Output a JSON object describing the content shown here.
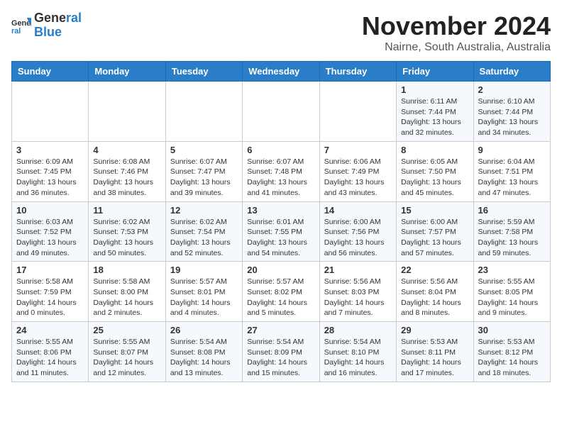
{
  "header": {
    "logo_line1": "General",
    "logo_line2": "Blue",
    "month": "November 2024",
    "location": "Nairne, South Australia, Australia"
  },
  "days_of_week": [
    "Sunday",
    "Monday",
    "Tuesday",
    "Wednesday",
    "Thursday",
    "Friday",
    "Saturday"
  ],
  "weeks": [
    [
      {
        "day": "",
        "info": ""
      },
      {
        "day": "",
        "info": ""
      },
      {
        "day": "",
        "info": ""
      },
      {
        "day": "",
        "info": ""
      },
      {
        "day": "",
        "info": ""
      },
      {
        "day": "1",
        "info": "Sunrise: 6:11 AM\nSunset: 7:44 PM\nDaylight: 13 hours\nand 32 minutes."
      },
      {
        "day": "2",
        "info": "Sunrise: 6:10 AM\nSunset: 7:44 PM\nDaylight: 13 hours\nand 34 minutes."
      }
    ],
    [
      {
        "day": "3",
        "info": "Sunrise: 6:09 AM\nSunset: 7:45 PM\nDaylight: 13 hours\nand 36 minutes."
      },
      {
        "day": "4",
        "info": "Sunrise: 6:08 AM\nSunset: 7:46 PM\nDaylight: 13 hours\nand 38 minutes."
      },
      {
        "day": "5",
        "info": "Sunrise: 6:07 AM\nSunset: 7:47 PM\nDaylight: 13 hours\nand 39 minutes."
      },
      {
        "day": "6",
        "info": "Sunrise: 6:07 AM\nSunset: 7:48 PM\nDaylight: 13 hours\nand 41 minutes."
      },
      {
        "day": "7",
        "info": "Sunrise: 6:06 AM\nSunset: 7:49 PM\nDaylight: 13 hours\nand 43 minutes."
      },
      {
        "day": "8",
        "info": "Sunrise: 6:05 AM\nSunset: 7:50 PM\nDaylight: 13 hours\nand 45 minutes."
      },
      {
        "day": "9",
        "info": "Sunrise: 6:04 AM\nSunset: 7:51 PM\nDaylight: 13 hours\nand 47 minutes."
      }
    ],
    [
      {
        "day": "10",
        "info": "Sunrise: 6:03 AM\nSunset: 7:52 PM\nDaylight: 13 hours\nand 49 minutes."
      },
      {
        "day": "11",
        "info": "Sunrise: 6:02 AM\nSunset: 7:53 PM\nDaylight: 13 hours\nand 50 minutes."
      },
      {
        "day": "12",
        "info": "Sunrise: 6:02 AM\nSunset: 7:54 PM\nDaylight: 13 hours\nand 52 minutes."
      },
      {
        "day": "13",
        "info": "Sunrise: 6:01 AM\nSunset: 7:55 PM\nDaylight: 13 hours\nand 54 minutes."
      },
      {
        "day": "14",
        "info": "Sunrise: 6:00 AM\nSunset: 7:56 PM\nDaylight: 13 hours\nand 56 minutes."
      },
      {
        "day": "15",
        "info": "Sunrise: 6:00 AM\nSunset: 7:57 PM\nDaylight: 13 hours\nand 57 minutes."
      },
      {
        "day": "16",
        "info": "Sunrise: 5:59 AM\nSunset: 7:58 PM\nDaylight: 13 hours\nand 59 minutes."
      }
    ],
    [
      {
        "day": "17",
        "info": "Sunrise: 5:58 AM\nSunset: 7:59 PM\nDaylight: 14 hours\nand 0 minutes."
      },
      {
        "day": "18",
        "info": "Sunrise: 5:58 AM\nSunset: 8:00 PM\nDaylight: 14 hours\nand 2 minutes."
      },
      {
        "day": "19",
        "info": "Sunrise: 5:57 AM\nSunset: 8:01 PM\nDaylight: 14 hours\nand 4 minutes."
      },
      {
        "day": "20",
        "info": "Sunrise: 5:57 AM\nSunset: 8:02 PM\nDaylight: 14 hours\nand 5 minutes."
      },
      {
        "day": "21",
        "info": "Sunrise: 5:56 AM\nSunset: 8:03 PM\nDaylight: 14 hours\nand 7 minutes."
      },
      {
        "day": "22",
        "info": "Sunrise: 5:56 AM\nSunset: 8:04 PM\nDaylight: 14 hours\nand 8 minutes."
      },
      {
        "day": "23",
        "info": "Sunrise: 5:55 AM\nSunset: 8:05 PM\nDaylight: 14 hours\nand 9 minutes."
      }
    ],
    [
      {
        "day": "24",
        "info": "Sunrise: 5:55 AM\nSunset: 8:06 PM\nDaylight: 14 hours\nand 11 minutes."
      },
      {
        "day": "25",
        "info": "Sunrise: 5:55 AM\nSunset: 8:07 PM\nDaylight: 14 hours\nand 12 minutes."
      },
      {
        "day": "26",
        "info": "Sunrise: 5:54 AM\nSunset: 8:08 PM\nDaylight: 14 hours\nand 13 minutes."
      },
      {
        "day": "27",
        "info": "Sunrise: 5:54 AM\nSunset: 8:09 PM\nDaylight: 14 hours\nand 15 minutes."
      },
      {
        "day": "28",
        "info": "Sunrise: 5:54 AM\nSunset: 8:10 PM\nDaylight: 14 hours\nand 16 minutes."
      },
      {
        "day": "29",
        "info": "Sunrise: 5:53 AM\nSunset: 8:11 PM\nDaylight: 14 hours\nand 17 minutes."
      },
      {
        "day": "30",
        "info": "Sunrise: 5:53 AM\nSunset: 8:12 PM\nDaylight: 14 hours\nand 18 minutes."
      }
    ]
  ]
}
